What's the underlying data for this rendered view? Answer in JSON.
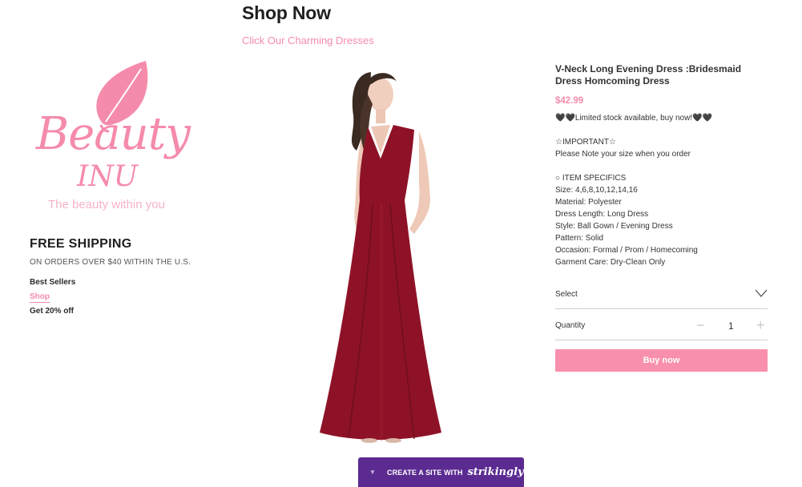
{
  "colors": {
    "accent": "#f58bab",
    "button": "#f78fad",
    "banner": "#5b2b91",
    "dress": "#8e1227"
  },
  "header": {
    "title": "Shop Now",
    "subtitle": "Click Our Charming Dresses"
  },
  "logo": {
    "brand_line1": "Beauty",
    "brand_line2": "INU",
    "tagline": "The beauty within you",
    "icon": "leaf-icon"
  },
  "promo": {
    "heading": "FREE SHIPPING",
    "subheading": "ON ORDERS OVER $40 WITHIN THE U.S.",
    "best_sellers": "Best Sellers",
    "shop_link": "Shop",
    "discount": "Get 20% off"
  },
  "product": {
    "name": "V-Neck Long Evening Dress :Bridesmaid Dress Homcoming Dress",
    "price": "$42.99",
    "stock_note": "🖤🖤Limited stock available, buy now!🖤🖤",
    "important_heading": "☆IMPORTANT☆",
    "important_note": "Please Note your size when you order",
    "specs_heading": "○ ITEM SPECIFICS",
    "specs": [
      "Size: 4,6,8,10,12,14,16",
      "Material: Polyester",
      "Dress Length: Long Dress",
      "Style: Ball Gown / Evening Dress",
      "Pattern: Solid",
      "Occasion: Formal / Prom / Homecoming",
      "Garment Care: Dry-Clean Only"
    ],
    "select_label": "Select",
    "quantity_label": "Quantity",
    "quantity_value": "1",
    "minus_symbol": "−",
    "plus_symbol": "+",
    "buy_label": "Buy now"
  },
  "banner": {
    "arrow": "▼",
    "text": "CREATE A SITE WITH",
    "brand": "strikingly"
  }
}
